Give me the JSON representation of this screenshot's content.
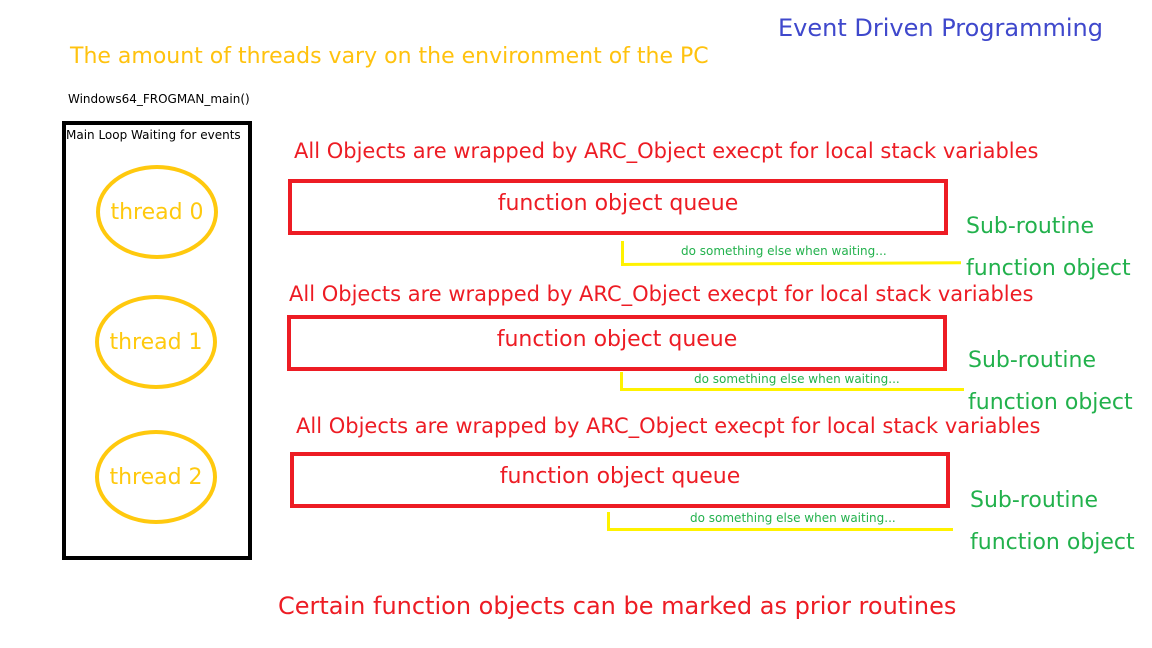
{
  "title": "Event Driven Programming",
  "thread_note": "The amount of threads vary on the environment of the PC",
  "main_function": "Windows64_FROGMAN_main()",
  "main_loop_label": "Main Loop Waiting for events",
  "threads": [
    "thread 0",
    "thread 1",
    "thread 2"
  ],
  "rows": [
    {
      "wrap_note": "All Objects are wrapped by ARC_Object execpt for local stack variables",
      "queue_label": "function object queue",
      "waiting_label": "do something else when waiting...",
      "subroutine_label": "Sub-routine",
      "function_object_label": "function object"
    },
    {
      "wrap_note": "All Objects are wrapped by ARC_Object execpt for local stack variables",
      "queue_label": "function object queue",
      "waiting_label": "do something else when waiting...",
      "subroutine_label": "Sub-routine",
      "function_object_label": "function object"
    },
    {
      "wrap_note": "All Objects are wrapped by ARC_Object execpt for local stack variables",
      "queue_label": "function object queue",
      "waiting_label": "do something else when waiting...",
      "subroutine_label": "Sub-routine",
      "function_object_label": "function object"
    }
  ],
  "footer_note": "Certain function objects can be marked as prior routines",
  "colors": {
    "title": "#3f48cc",
    "thread": "#ffc90e",
    "queue": "#ed1c24",
    "waiting_line": "#fff200",
    "subroutine": "#22b14c"
  }
}
